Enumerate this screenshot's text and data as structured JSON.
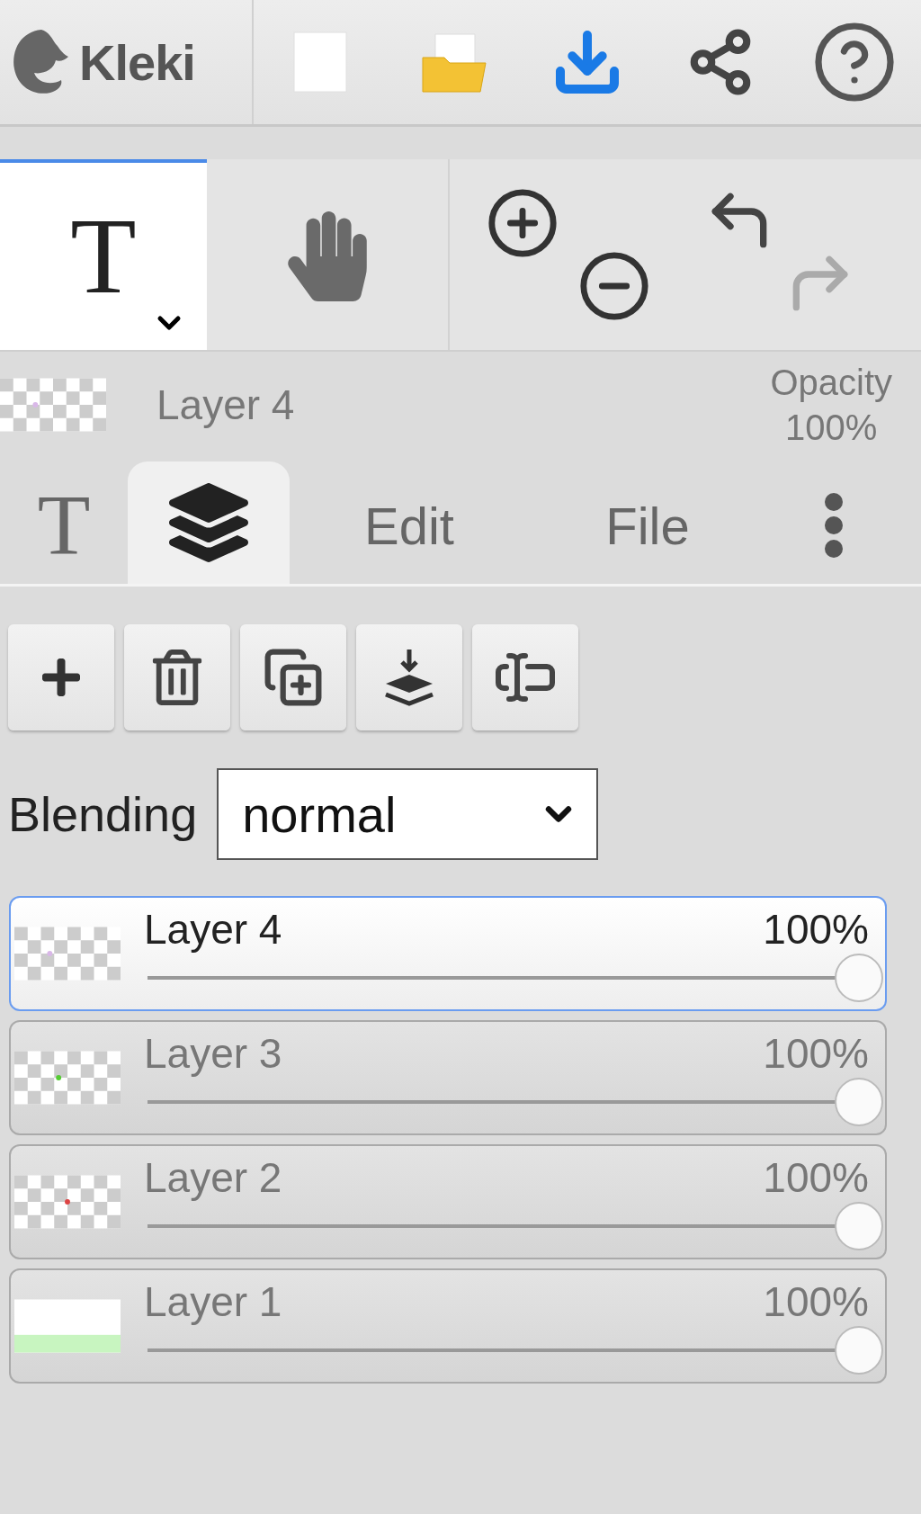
{
  "app": {
    "logo": "Kleki"
  },
  "tools": [
    {
      "kind": "text",
      "label": "T",
      "selected": true
    },
    {
      "kind": "hand",
      "selected": false
    }
  ],
  "history": [
    {
      "kind": "undo",
      "disabled": false
    },
    {
      "kind": "redo",
      "disabled": true
    }
  ],
  "current_layer": {
    "name": "Layer 4",
    "opacity_label": "Opacity",
    "opacity": "100%"
  },
  "tabs": [
    {
      "kind": "text",
      "label": "T",
      "selected": false
    },
    {
      "kind": "layers",
      "selected": true
    },
    {
      "kind": "text",
      "label": "Edit",
      "selected": false
    },
    {
      "kind": "text",
      "label": "File",
      "selected": false
    },
    {
      "kind": "more",
      "selected": false
    }
  ],
  "blending": {
    "label": "Blending",
    "value": "normal"
  },
  "layers": [
    {
      "name": "Layer 4",
      "opacity": "100%",
      "level": 1,
      "selected": true
    },
    {
      "name": "Layer 3",
      "opacity": "100%",
      "level": 1,
      "selected": false
    },
    {
      "name": "Layer 2",
      "opacity": "100%",
      "level": 1,
      "selected": false
    },
    {
      "name": "Layer 1",
      "opacity": "100%",
      "level": 1,
      "selected": false
    }
  ]
}
